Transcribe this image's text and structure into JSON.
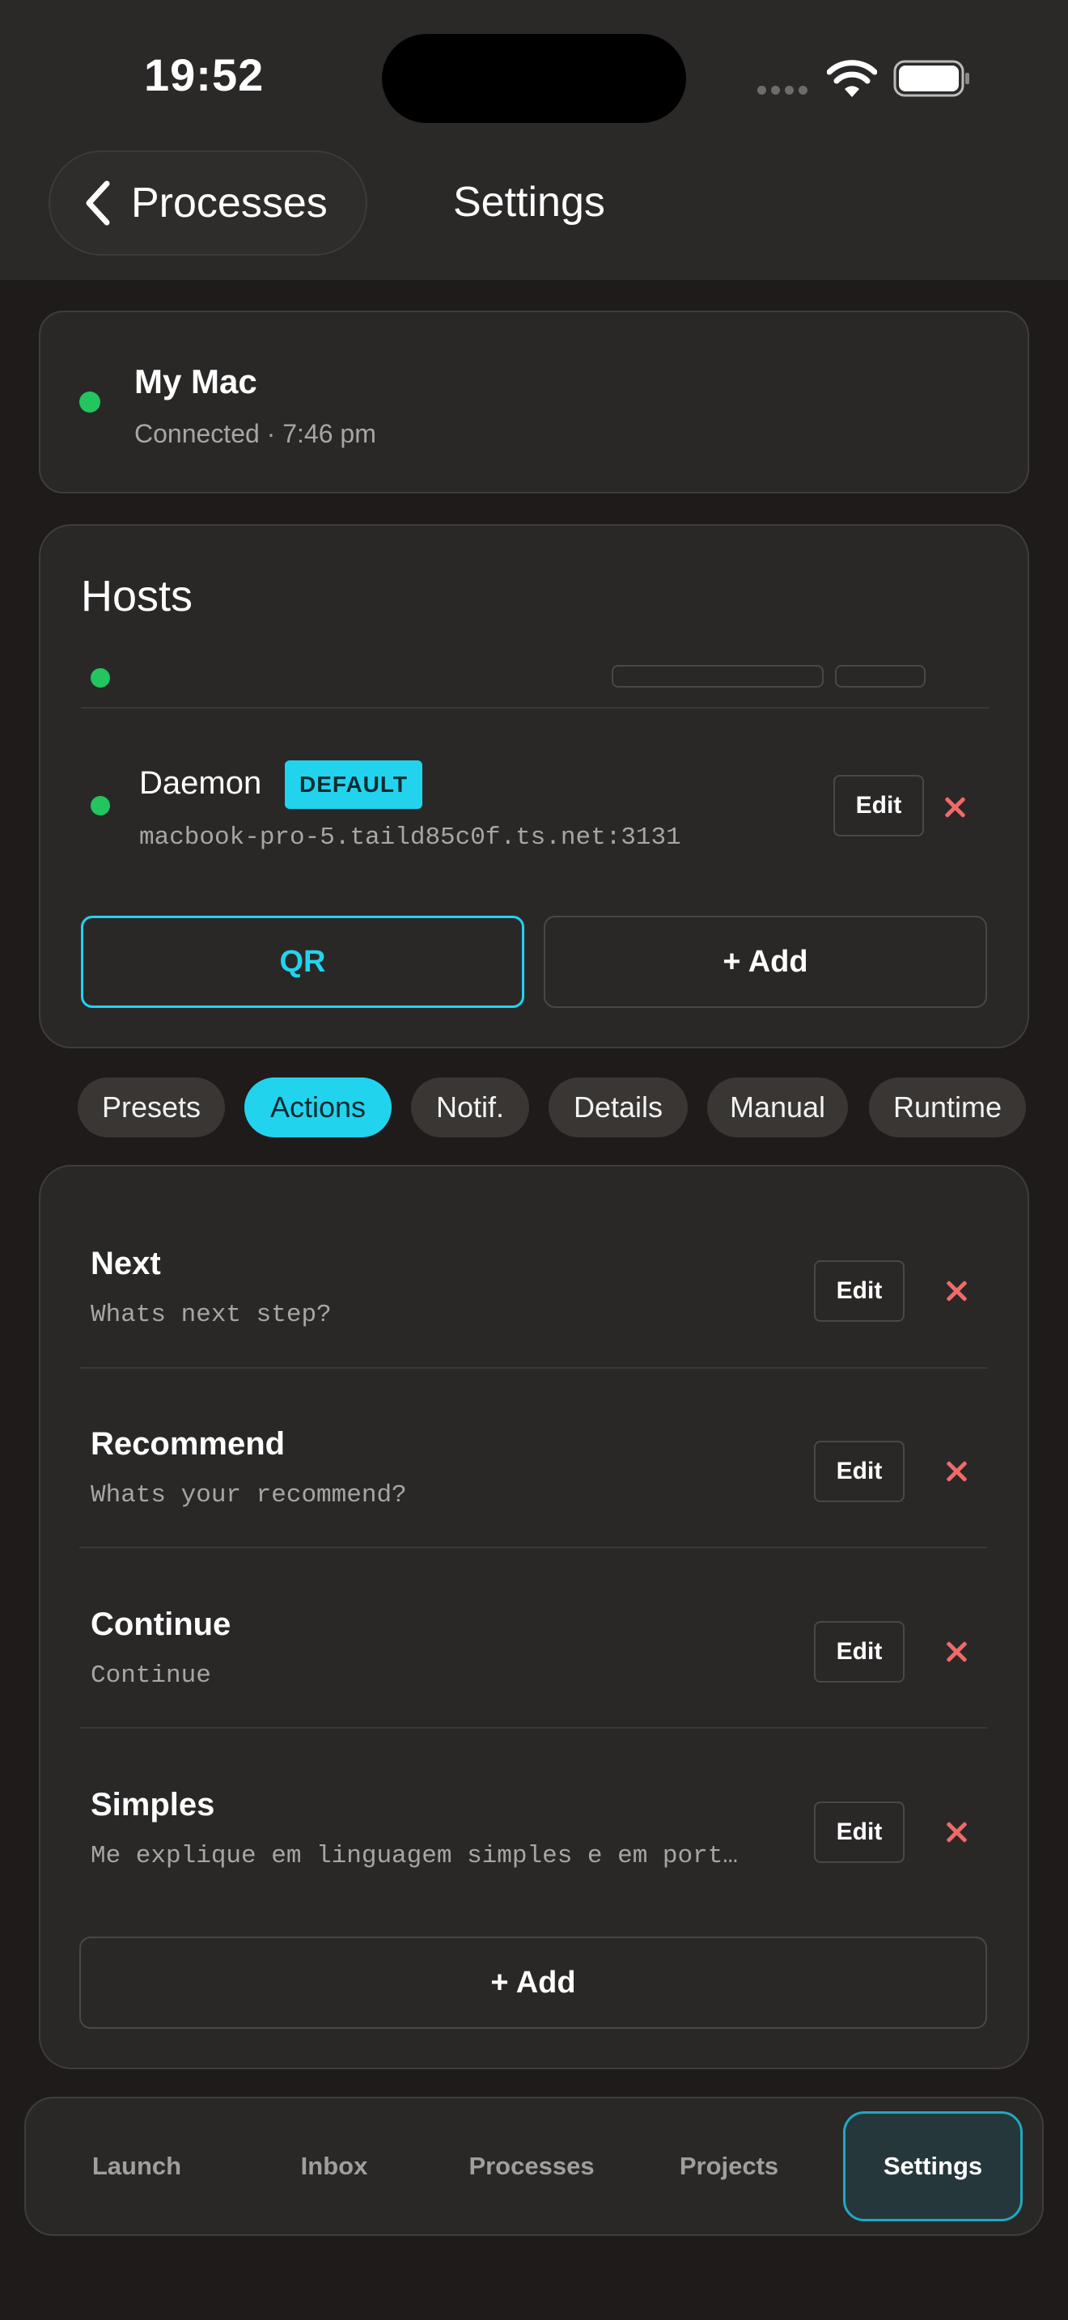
{
  "status_bar": {
    "time": "19:52"
  },
  "header": {
    "back_label": "Processes",
    "title": "Settings"
  },
  "connection": {
    "name": "My Mac",
    "status": "Connected · 7:46 pm",
    "status_color": "#22c55e"
  },
  "hosts": {
    "title": "Hosts",
    "items": [
      {
        "name": "Daemon",
        "badge": "DEFAULT",
        "address": "macbook-pro-5.taild85c0f.ts.net:3131",
        "edit_label": "Edit"
      }
    ],
    "qr_label": "QR",
    "add_label": "+ Add"
  },
  "tabs": [
    {
      "label": "Presets",
      "active": false
    },
    {
      "label": "Actions",
      "active": true
    },
    {
      "label": "Notif.",
      "active": false
    },
    {
      "label": "Details",
      "active": false
    },
    {
      "label": "Manual",
      "active": false
    },
    {
      "label": "Runtime",
      "active": false
    }
  ],
  "actions": {
    "items": [
      {
        "title": "Next",
        "prompt": "Whats next step?",
        "edit_label": "Edit"
      },
      {
        "title": "Recommend",
        "prompt": "Whats your recommend?",
        "edit_label": "Edit"
      },
      {
        "title": "Continue",
        "prompt": "Continue",
        "edit_label": "Edit"
      },
      {
        "title": "Simples",
        "prompt": "Me explique em linguagem simples e em port…",
        "edit_label": "Edit"
      }
    ],
    "add_label": "+ Add"
  },
  "bottom_nav": [
    {
      "label": "Launch",
      "active": false
    },
    {
      "label": "Inbox",
      "active": false
    },
    {
      "label": "Processes",
      "active": false
    },
    {
      "label": "Projects",
      "active": false
    },
    {
      "label": "Settings",
      "active": true
    }
  ],
  "colors": {
    "accent": "#22d3ee",
    "danger": "#f06a6a",
    "online": "#22c55e"
  }
}
